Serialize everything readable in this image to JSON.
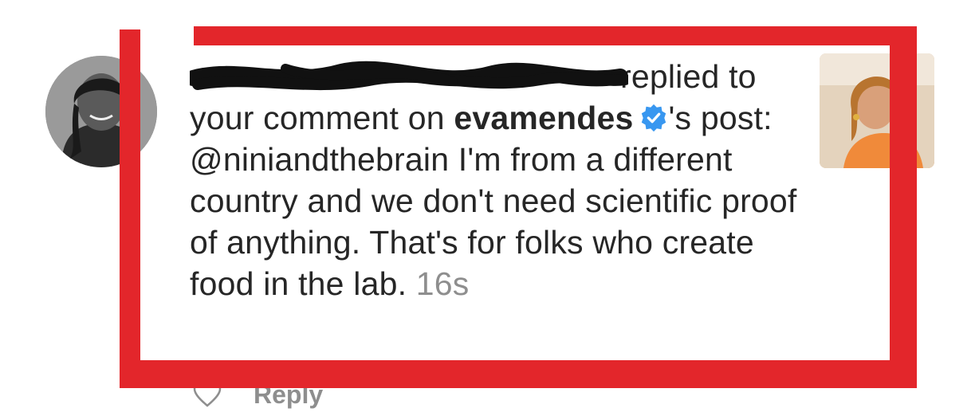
{
  "notification": {
    "username_redacted": "",
    "action": "replied to your comment on",
    "account": "evamendes",
    "account_suffix": "'s",
    "post_prefix": "post:",
    "body": "@niniandthebrain I'm from a different country and we don't need scientific proof of anything. That's for folks who create food in the lab.",
    "time": "16s"
  },
  "actions": {
    "reply_label": "Reply"
  },
  "icons": {
    "verified": "verified-badge-icon",
    "like": "heart-icon"
  },
  "colors": {
    "annotation": "#e3262b",
    "verified": "#3897f0",
    "muted": "#8e8e8e",
    "text": "#262626"
  }
}
